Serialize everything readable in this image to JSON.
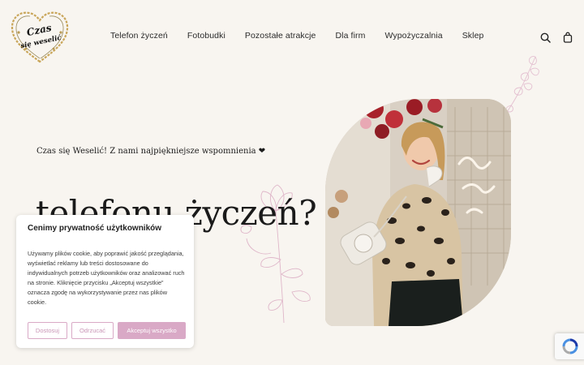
{
  "logo": {
    "line1": "Czas",
    "line2": "się weselić"
  },
  "nav": [
    {
      "label": "Telefon życzeń"
    },
    {
      "label": "Fotobudki"
    },
    {
      "label": "Pozostałe atrakcje"
    },
    {
      "label": "Dla firm"
    },
    {
      "label": "Wypożyczalnia"
    },
    {
      "label": "Sklep"
    }
  ],
  "header_icons": [
    "search-icon",
    "shopping-bag-icon"
  ],
  "hero": {
    "tagline": "Czas się Weselić! Z nami najpiękniejsze wspomnienia ❤",
    "headline": "telefonu życzeń?"
  },
  "cookie": {
    "title": "Cenimy prywatność użytkowników",
    "body": "Używamy plików cookie, aby poprawić jakość przeglądania, wyświetlać reklamy lub treści dostosowane do indywidualnych potrzeb użytkowników oraz analizować ruch na stronie. Kliknięcie przycisku „Akceptuj wszystkie” oznacza zgodę na wykorzystywanie przez nas plików cookie.",
    "customize": "Dostosuj",
    "reject": "Odrzucać",
    "accept": "Akceptuj wszystko"
  },
  "colors": {
    "background": "#f8f5f0",
    "accent_pink": "#d9a9c6",
    "logo_gold": "#c9a65a"
  }
}
